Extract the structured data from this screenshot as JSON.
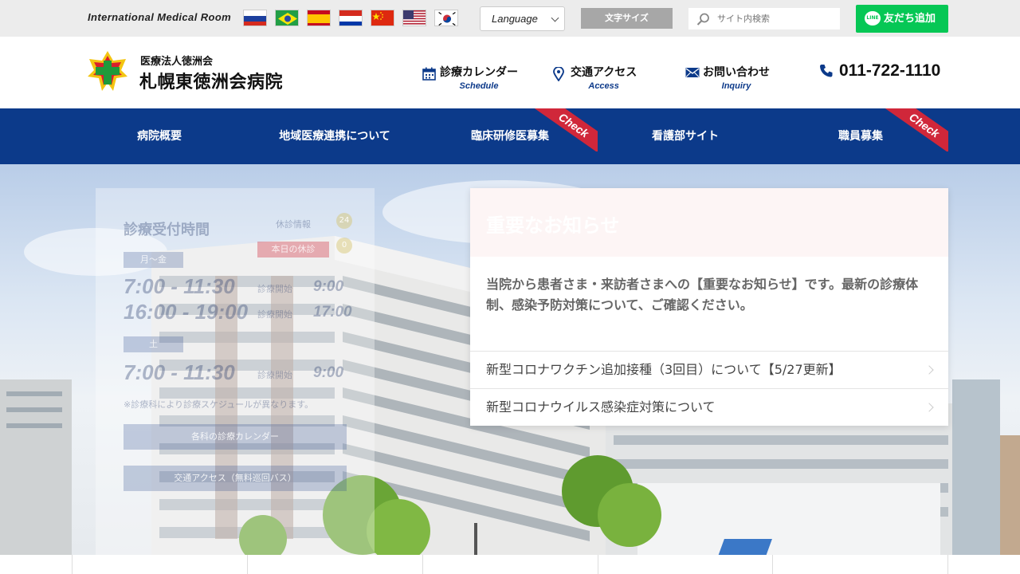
{
  "topbar": {
    "intl_room": "International Medical Room",
    "flags": [
      {
        "name": "russia-flag"
      },
      {
        "name": "brazil-flag"
      },
      {
        "name": "spain-flag"
      },
      {
        "name": "paraguay-flag"
      },
      {
        "name": "china-flag"
      },
      {
        "name": "usa-flag"
      },
      {
        "name": "korea-flag"
      }
    ],
    "language_label": "Language",
    "font_size_label": "文字サイズ",
    "search_placeholder": "サイト内検索",
    "line_button_label": "友だち追加",
    "line_icon_text": "LINE"
  },
  "header": {
    "corporation": "医療法人徳洲会",
    "hospital_name": "札幌東徳洲会病院",
    "links": [
      {
        "jp": "診療カレンダー",
        "en": "Schedule",
        "icon": "calendar-icon"
      },
      {
        "jp": "交通アクセス",
        "en": "Access",
        "icon": "map-pin-icon"
      },
      {
        "jp": "お問い合わせ",
        "en": "Inquiry",
        "icon": "mail-icon"
      }
    ],
    "phone": "011-722-1110"
  },
  "nav": {
    "items": [
      {
        "label": "病院概要",
        "check": false
      },
      {
        "label": "地域医療連携について",
        "check": false
      },
      {
        "label": "臨床研修医募集",
        "check": true
      },
      {
        "label": "看護部サイト",
        "check": false
      },
      {
        "label": "職員募集",
        "check": true
      }
    ],
    "check_label": "Check"
  },
  "hours": {
    "title": "診療受付時間",
    "holiday_info": "休診情報",
    "holiday_button": "本日の休診",
    "count1": "24",
    "count2": "0",
    "weekday_label": "月～金",
    "weekday_time1": "7:00 - 11:30",
    "weekday_time2": "16:00 - 19:00",
    "start_label": "診療開始",
    "start_time1": "9:00",
    "start_time2": "17:00",
    "saturday_label": "土",
    "saturday_time": "7:00 - 11:30",
    "saturday_start": "9:00",
    "note": "※診療科により診療スケジュールが異なります。",
    "calendar_button": "各科の診療カレンダー",
    "access_button": "交通アクセス（無料巡回バス）"
  },
  "notice": {
    "title": "重要なお知らせ",
    "intro": "当院から患者さま・来訪者さまへの【重要なお知らせ】です。最新の診療体制、感染予防対策について、ご確認ください。",
    "items": [
      "新型コロナワクチン追加接種（3回目）について【5/27更新】",
      "新型コロナウイルス感染症対策について"
    ]
  },
  "colors": {
    "brand_blue": "#0c3a8a",
    "check_red": "#d0273a",
    "line_green": "#06c755"
  }
}
